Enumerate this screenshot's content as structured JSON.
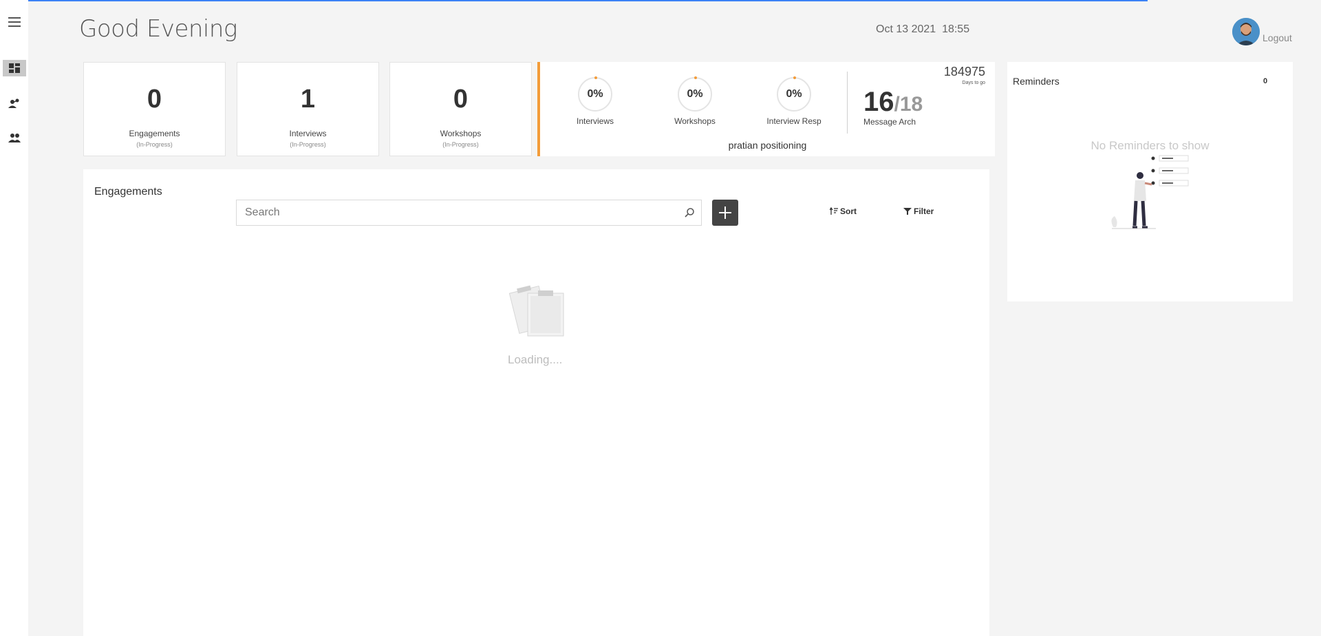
{
  "header": {
    "greeting": "Good Evening",
    "datetime": "Oct 13 2021  18:55",
    "logout_label": "Logout"
  },
  "sidebar": {
    "items": [
      {
        "icon": "menu-icon"
      },
      {
        "icon": "dashboard-icon",
        "active": true
      },
      {
        "icon": "user-engage-icon"
      },
      {
        "icon": "group-icon"
      }
    ]
  },
  "stats": [
    {
      "value": "0",
      "label": "Engagements",
      "sub": "(In-Progress)"
    },
    {
      "value": "1",
      "label": "Interviews",
      "sub": "(In-Progress)"
    },
    {
      "value": "0",
      "label": "Workshops",
      "sub": "(In-Progress)"
    }
  ],
  "positioning": {
    "days_value": "184975",
    "days_label": "Days to go",
    "rings": [
      {
        "value": "0%",
        "label": "Interviews"
      },
      {
        "value": "0%",
        "label": "Workshops"
      },
      {
        "value": "0%",
        "label": "Interview Resp"
      }
    ],
    "message_arch_current": "16",
    "message_arch_total": "/18",
    "message_arch_label": "Message Arch",
    "name": "pratian positioning",
    "accent_color": "#f39c3a"
  },
  "reminders": {
    "title": "Reminders",
    "count": "0",
    "empty_text": "No Reminders to show"
  },
  "engagements": {
    "title": "Engagements",
    "search_placeholder": "Search",
    "sort_label": "Sort",
    "filter_label": "Filter",
    "loading_text": "Loading...."
  },
  "colors": {
    "progress_bar": "#3b82f6",
    "add_button": "#444444"
  }
}
